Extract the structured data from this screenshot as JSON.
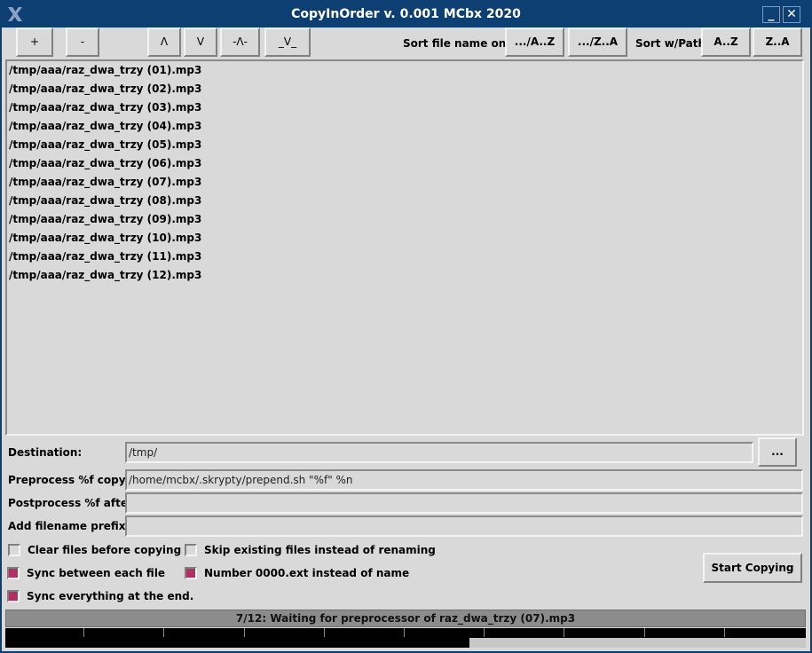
{
  "window": {
    "title": "CopyInOrder v. 0.001 MCbx 2020",
    "minimize_label": "_",
    "close_label": "✕"
  },
  "toolbar": {
    "add_label": "+",
    "remove_label": "-",
    "up_label": "Λ",
    "down_label": "V",
    "top_label": "-Λ-",
    "bottom_label": "_V_",
    "sort_name_only_label": "Sort file name only:",
    "name_az_label": ".../A..Z",
    "name_za_label": ".../Z..A",
    "sort_path_label": "Sort w/Path:",
    "path_az_label": "A..Z",
    "path_za_label": "Z..A"
  },
  "files": [
    "/tmp/aaa/raz_dwa_trzy (01).mp3",
    "/tmp/aaa/raz_dwa_trzy (02).mp3",
    "/tmp/aaa/raz_dwa_trzy (03).mp3",
    "/tmp/aaa/raz_dwa_trzy (04).mp3",
    "/tmp/aaa/raz_dwa_trzy (05).mp3",
    "/tmp/aaa/raz_dwa_trzy (06).mp3",
    "/tmp/aaa/raz_dwa_trzy (07).mp3",
    "/tmp/aaa/raz_dwa_trzy (08).mp3",
    "/tmp/aaa/raz_dwa_trzy (09).mp3",
    "/tmp/aaa/raz_dwa_trzy (10).mp3",
    "/tmp/aaa/raz_dwa_trzy (11).mp3",
    "/tmp/aaa/raz_dwa_trzy (12).mp3"
  ],
  "form": {
    "destination_label": "Destination:",
    "destination_value": "/tmp/",
    "browse_label": "...",
    "preprocess_label": "Preprocess %f copy:",
    "preprocess_value": "/home/mcbx/.skrypty/prepend.sh \"%f\" %n",
    "postprocess_label": "Postprocess %f  after:",
    "postprocess_value": "",
    "prefix_label": "Add filename prefix:",
    "prefix_value": ""
  },
  "options": {
    "clear_files": {
      "label": "Clear files before copying",
      "checked": false
    },
    "skip_existing": {
      "label": "Skip existing files instead of renaming",
      "checked": false
    },
    "sync_each": {
      "label": "Sync between each file",
      "checked": true
    },
    "number_ext": {
      "label": "Number 0000.ext instead of name",
      "checked": true
    },
    "sync_end": {
      "label": "Sync everything at the end.",
      "checked": true
    }
  },
  "start_label": "Start Copying",
  "status": {
    "text": "7/12: Waiting for preprocessor of raz_dwa_trzy (07).mp3"
  },
  "colors": {
    "titlebar": "#0e3f73",
    "checkbox_on": "#b03060",
    "background": "#d9d9d9"
  }
}
